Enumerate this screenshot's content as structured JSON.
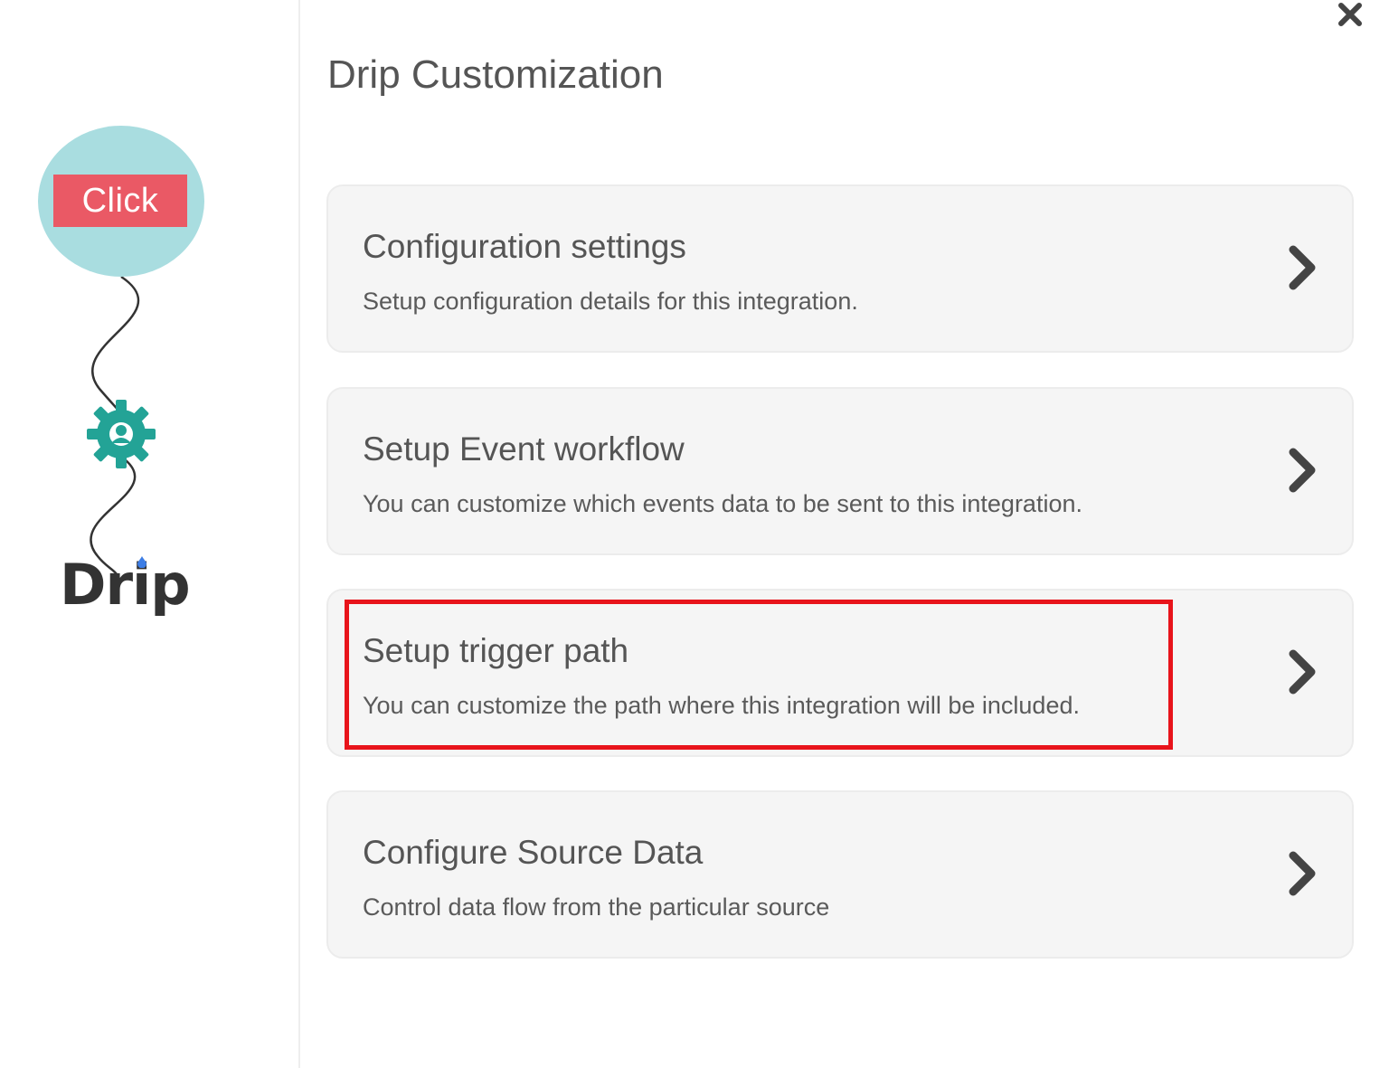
{
  "flow": {
    "source_label": "Click",
    "destination_logo": "Drip",
    "colors": {
      "source_circle": "#a9dde0",
      "source_badge": "#ea5965",
      "gear": "#23a396",
      "drip_drop": "#3d7de4"
    }
  },
  "header": {
    "title": "Drip Customization",
    "close_icon": "close-icon"
  },
  "options": [
    {
      "title": "Configuration settings",
      "description": "Setup configuration details for this integration."
    },
    {
      "title": "Setup Event workflow",
      "description": "You can customize which events data to be sent to this integration."
    },
    {
      "title": "Setup trigger path",
      "description": "You can customize the path where this integration will be included.",
      "highlighted": true
    },
    {
      "title": "Configure Source Data",
      "description": "Control data flow from the particular source"
    }
  ],
  "highlight_color": "#e8141b"
}
